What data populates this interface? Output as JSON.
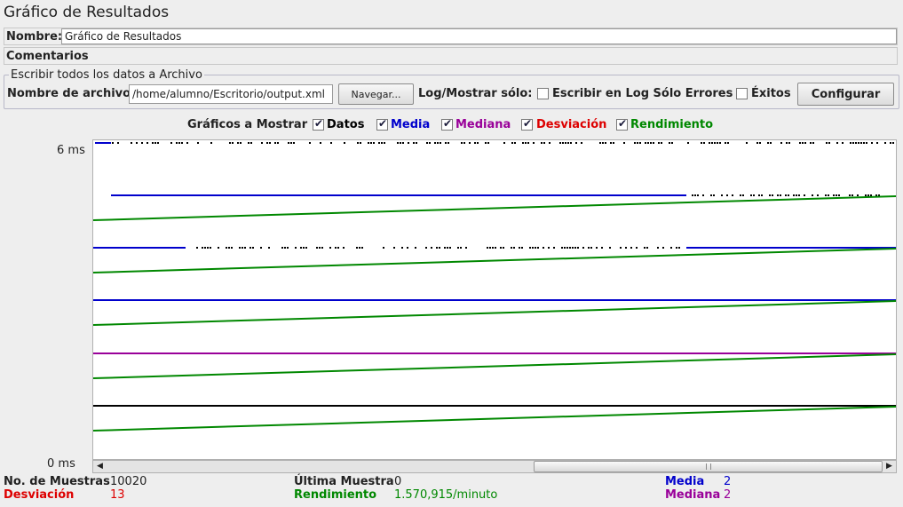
{
  "window": {
    "title": "Gráfico de Resultados"
  },
  "name_field": {
    "label": "Nombre:",
    "value": "Gráfico de Resultados"
  },
  "comments_field": {
    "label": "Comentarios",
    "value": ""
  },
  "file_group": {
    "title": "Escribir todos los datos a Archivo",
    "filename_label": "Nombre de archivo",
    "filename_value": "/home/alumno/Escritorio/output.xml",
    "browse_label": "Navegar...",
    "log_label": "Log/Mostrar sólo:",
    "errors_only_label": "Escribir en Log Sólo Errores",
    "errors_only_checked": false,
    "success_label": "Éxitos",
    "success_checked": false,
    "configure_label": "Configurar"
  },
  "graph_options": {
    "label": "Gráficos a Mostrar",
    "items": [
      {
        "label": "Datos",
        "checked": true,
        "color": "#000000"
      },
      {
        "label": "Media",
        "checked": true,
        "color": "#0000cc"
      },
      {
        "label": "Mediana",
        "checked": true,
        "color": "#990099"
      },
      {
        "label": "Desviación",
        "checked": true,
        "color": "#dd0000"
      },
      {
        "label": "Rendimiento",
        "checked": true,
        "color": "#008800"
      }
    ]
  },
  "axis": {
    "y_max_label": "6 ms",
    "y_min_label": "0 ms"
  },
  "chart_data": {
    "type": "line",
    "ylim": [
      0,
      6
    ],
    "grid": false,
    "series": [
      {
        "name": "Datos",
        "color": "#000000"
      },
      {
        "name": "Media",
        "color": "#0000cc"
      },
      {
        "name": "Mediana",
        "color": "#990099"
      },
      {
        "name": "Desviación",
        "color": "#dd0000"
      },
      {
        "name": "Rendimiento",
        "color": "#008800"
      }
    ]
  },
  "stats": {
    "samples_label": "No. de Muestras",
    "samples_value": "10020",
    "last_sample_label": "Última Muestra",
    "last_sample_value": "0",
    "media_label": "Media",
    "media_value": "2",
    "deviation_label": "Desviación",
    "deviation_value": "13",
    "throughput_label": "Rendimiento",
    "throughput_value": "1.570,915/minuto",
    "median_label": "Mediana",
    "median_value": "2"
  }
}
